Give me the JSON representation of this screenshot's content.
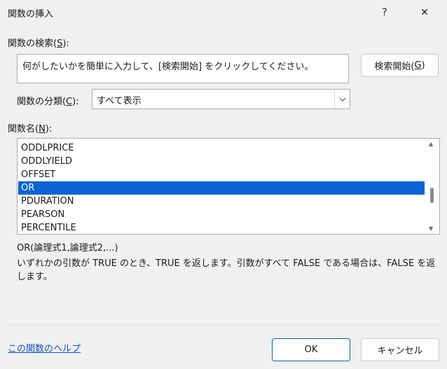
{
  "window": {
    "title": "関数の挿入",
    "help": "?",
    "close": "✕"
  },
  "search": {
    "label_prefix": "関数の検索(",
    "label_key": "S",
    "label_suffix": "):",
    "value": "何がしたいかを簡単に入力して、[検索開始] をクリックしてください。",
    "button_prefix": "検索開始(",
    "button_key": "G",
    "button_suffix": ")"
  },
  "category": {
    "label_prefix": "関数の分類(",
    "label_key": "C",
    "label_suffix": "):",
    "selected": "すべて表示"
  },
  "function_list": {
    "label_prefix": "関数名(",
    "label_key": "N",
    "label_suffix": "):",
    "items": [
      "ODDLPRICE",
      "ODDLYIELD",
      "OFFSET",
      "OR",
      "PDURATION",
      "PEARSON",
      "PERCENTILE"
    ],
    "selected_index": 3
  },
  "details": {
    "syntax": "OR(論理式1,論理式2,...)",
    "description": "いずれかの引数が TRUE のとき、TRUE を返します。引数がすべて FALSE である場合は、FALSE を返します。"
  },
  "footer": {
    "help_link": "この関数のヘルプ",
    "ok": "OK",
    "cancel": "キャンセル"
  },
  "colors": {
    "accent": "#0a64d6",
    "link": "#0a56c4"
  }
}
